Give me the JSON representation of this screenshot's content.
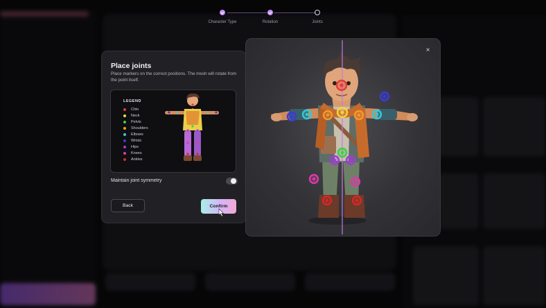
{
  "stepper": {
    "steps": [
      {
        "label": "Character Type",
        "state": "done"
      },
      {
        "label": "Rotation",
        "state": "done"
      },
      {
        "label": "Joints",
        "state": "current"
      }
    ]
  },
  "modal": {
    "title": "Place joints",
    "description": "Place markers on the correct positions. The mesh will rotate from the point itself.",
    "legend_title": "LEGEND",
    "legend": [
      {
        "label": "Chin",
        "color": "#e23b3b"
      },
      {
        "label": "Neck",
        "color": "#f2d640"
      },
      {
        "label": "Pelvis",
        "color": "#3fce4a"
      },
      {
        "label": "Shoulders",
        "color": "#f29a2e"
      },
      {
        "label": "Elbows",
        "color": "#35c9d6"
      },
      {
        "label": "Wrists",
        "color": "#3b3bd6"
      },
      {
        "label": "Hips",
        "color": "#a13bd8"
      },
      {
        "label": "Knees",
        "color": "#d83ba8"
      },
      {
        "label": "Ankles",
        "color": "#d62828"
      }
    ],
    "toggle_label": "Maintain joint symmetry",
    "toggle_on": false,
    "back_label": "Back",
    "confirm_label": "Confirm"
  },
  "viewer": {
    "close_icon": "×"
  }
}
